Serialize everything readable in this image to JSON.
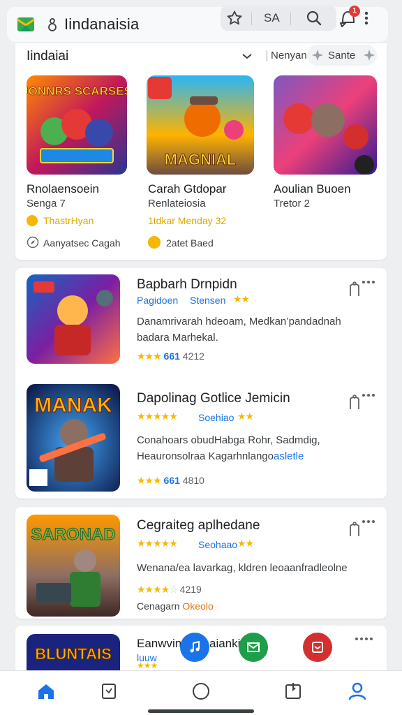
{
  "header": {
    "site_title": "Iindanaisia",
    "pill_text": "SA",
    "notification_count": "1"
  },
  "section": {
    "title": "Iindaiai",
    "filter_label": "Nenyan",
    "chip_label": "Sante"
  },
  "featured": [
    {
      "name": "Rnolaensoein",
      "sub": "Senga 7",
      "price": "ThastrHyan",
      "meta": "Aanyatsec Cagah",
      "thumb_text": "JONNRS SCARSES"
    },
    {
      "name": "Carah Gtdopar",
      "sub": "Renlateiosia",
      "price": "1tdkar Menday 32",
      "meta": "2atet Baed",
      "thumb_text": "MAGNIAL"
    },
    {
      "name": "Aoulian Buoen",
      "sub": "Tretor 2",
      "price": "",
      "meta": "",
      "thumb_text": ""
    }
  ],
  "list": [
    {
      "title": "Bapbarh Drnpidn",
      "tag": "Pagidoen",
      "tag2": "Stensen",
      "desc1": "Danamrivarah hdeoam, Medkan’pandadnah",
      "desc2": "badara Marhekal.",
      "desc_highlight": "",
      "rating": "661",
      "rating_count": "4212",
      "thumb_text": ""
    },
    {
      "title": "Dapolinag Gotlice Jemicin",
      "tag": "",
      "tag2": "Soehiao",
      "desc1": "Conahoars obudHabga Rohr, Sadmdig,",
      "desc2": "Heauronsolraa Kagarhnlango",
      "desc_highlight": "asletle",
      "rating": "661",
      "rating_count": "4810",
      "thumb_text": "MANAK"
    },
    {
      "title": "Cegraiteg aplhedane",
      "tag": "",
      "tag2": "Seohaao",
      "desc1": "Wenana/ea lavarkag, kldren leoaanfradleolne",
      "desc2": "",
      "desc_highlight": "",
      "rating": "",
      "rating_count": "4219",
      "sub_label": "Cenagarn",
      "sub_highlight": "Okeolo",
      "thumb_text": "SARONAD"
    },
    {
      "title": "Eanwvin",
      "title_tail": "aianki",
      "tag": "luuw",
      "tag2": "",
      "desc1": "",
      "desc2": "",
      "desc_highlight": "",
      "rating": "",
      "rating_count": "",
      "thumb_text": "BLUNTAIS"
    }
  ],
  "colors": {
    "accent": "#1a73e8",
    "star": "#f5b800",
    "fab_blue": "#1a73e8",
    "fab_green": "#1e9e4a",
    "fab_red": "#d32f2f"
  },
  "icons": [
    "app-logo-icon",
    "page-icon",
    "star-icon",
    "search-icon",
    "bell-icon",
    "more-vert-icon",
    "chevron-down-icon",
    "home-icon",
    "receipt-icon",
    "circle-icon",
    "book-icon",
    "profile-icon"
  ]
}
